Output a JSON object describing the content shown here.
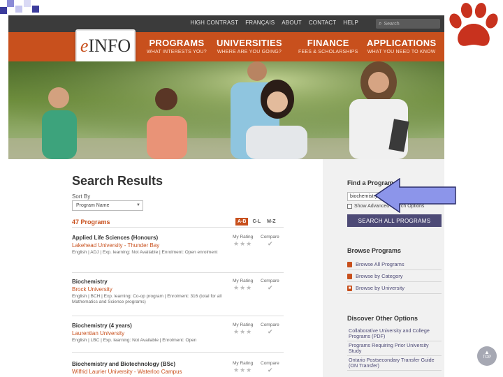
{
  "colors": {
    "accent": "#c8501d",
    "nav_dark": "#3b3b3b",
    "button": "#4d4a76",
    "arrow": "#8c95ea"
  },
  "utility": {
    "links": [
      "HIGH CONTRAST",
      "FRANÇAIS",
      "ABOUT",
      "CONTACT",
      "HELP"
    ],
    "search_placeholder": "Search"
  },
  "logo": {
    "prefix": "e",
    "name": "INFO"
  },
  "nav": [
    {
      "label": "PROGRAMS",
      "sub": "WHAT INTERESTS YOU?"
    },
    {
      "label": "UNIVERSITIES",
      "sub": "WHERE ARE YOU GOING?"
    },
    {
      "label": "FINANCE",
      "sub": "FEES & SCHOLARSHIPS"
    },
    {
      "label": "APPLICATIONS",
      "sub": "WHAT YOU NEED TO KNOW"
    }
  ],
  "main": {
    "title": "Search Results",
    "sort_label": "Sort By",
    "sort_value": "Program Name",
    "count": "47 Programs",
    "alpha": [
      "A-B",
      "C-L",
      "M-Z"
    ],
    "rating_label": "My Rating",
    "compare_label": "Compare",
    "results": [
      {
        "title": "Applied Life Sciences (Honours)",
        "institution": "Lakehead University - Thunder Bay",
        "meta": "English | ADJ | Exp. learning: Not Available | Enrolment: Open enrolment"
      },
      {
        "title": "Biochemistry",
        "institution": "Brock University",
        "meta": "English | BCH | Exp. learning: Co-op program | Enrolment: 316 (total for all Mathematics and Science programs)"
      },
      {
        "title": "Biochemistry (4 years)",
        "institution": "Laurentian University",
        "meta": "English | LBC | Exp. learning: Not Available | Enrolment: Open"
      },
      {
        "title": "Biochemistry and Biotechnology (BSc)",
        "institution": "Wilfrid Laurier University - Waterloo Campus",
        "meta": ""
      }
    ]
  },
  "sidebar": {
    "find_title": "Find a Program",
    "find_value": "biochemistry",
    "advanced_label": "Show Advanced Search Options",
    "search_button": "SEARCH ALL PROGRAMS",
    "browse_title": "Browse Programs",
    "browse_items": [
      "Browse All Programs",
      "Browse by Category",
      "Browse by University"
    ],
    "discover_title": "Discover Other Options",
    "discover_items": [
      "Collaborative University and College Programs (PDF)",
      "Programs Requiring Prior University Study",
      "Ontario Postsecondary Transfer Guide (ON Transfer)"
    ]
  },
  "back_to_top": "TOP"
}
